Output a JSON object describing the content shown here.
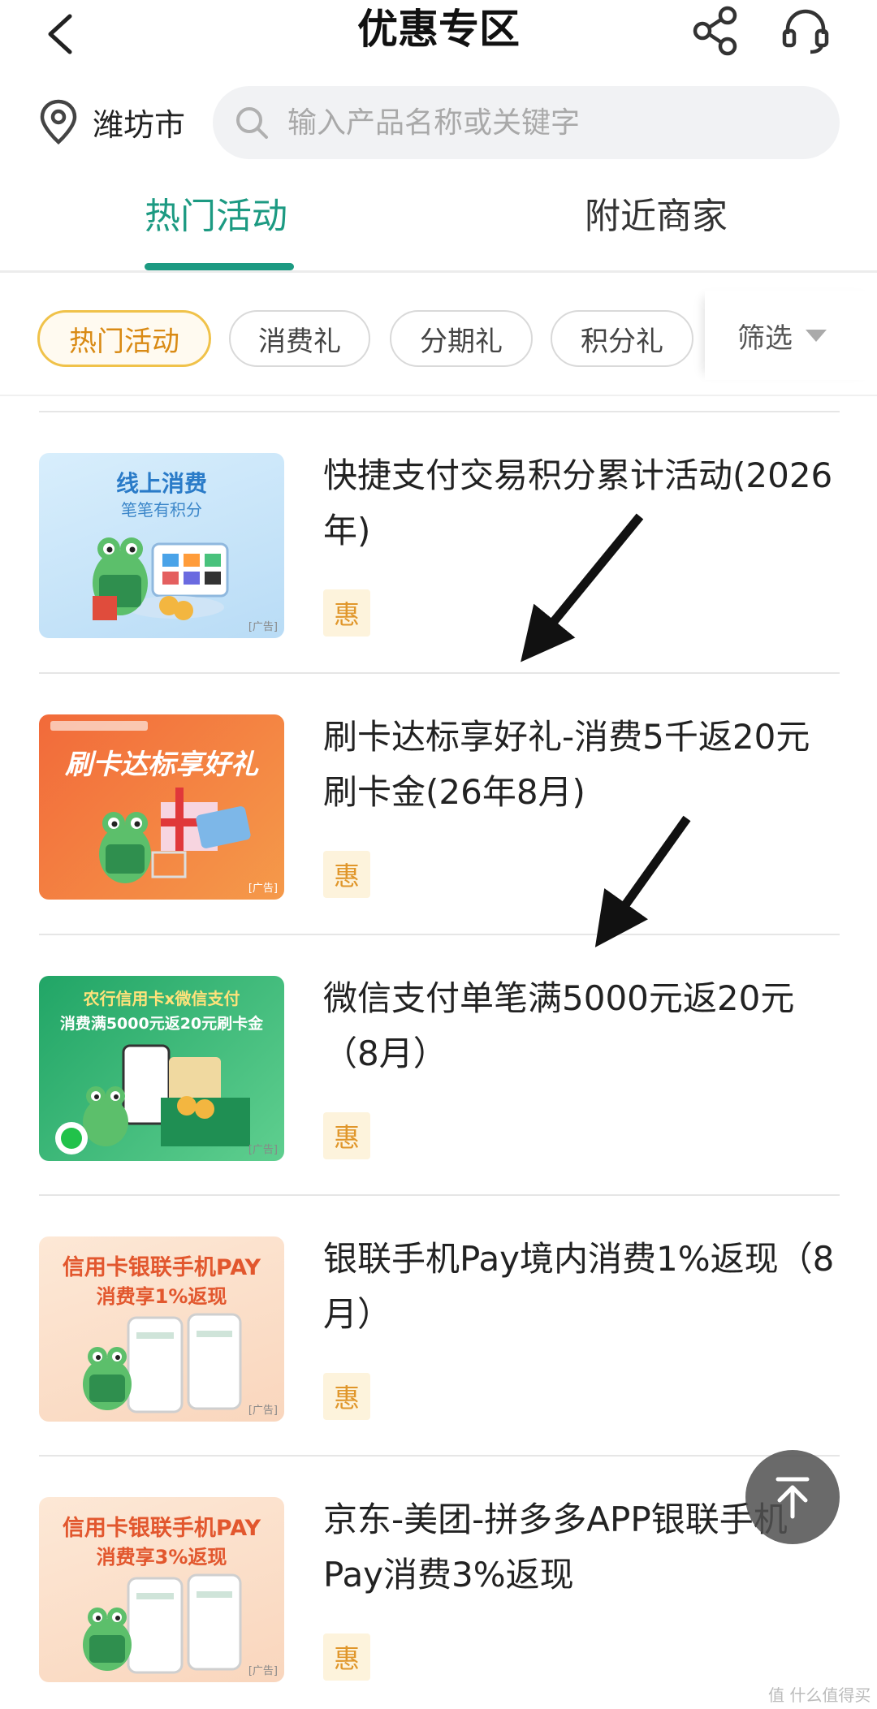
{
  "header": {
    "title": "优惠专区",
    "back_icon": "chevron-left-icon",
    "share_icon": "share-icon",
    "support_icon": "headset-icon"
  },
  "location": {
    "icon": "location-pin-icon",
    "city": "潍坊市"
  },
  "search": {
    "placeholder": "输入产品名称或关键字",
    "icon": "search-icon"
  },
  "tabs": [
    {
      "label": "热门活动",
      "active": true
    },
    {
      "label": "附近商家",
      "active": false
    }
  ],
  "chips": [
    {
      "label": "热门活动",
      "active": true
    },
    {
      "label": "消费礼",
      "active": false
    },
    {
      "label": "分期礼",
      "active": false
    },
    {
      "label": "积分礼",
      "active": false
    }
  ],
  "filter": {
    "label": "筛选"
  },
  "items": [
    {
      "title": "快捷支付交易积分累计活动(2026年)",
      "badge": "惠",
      "thumb": {
        "line1": "线上消费",
        "line2": "笔笔有积分",
        "ad": "[广告]"
      }
    },
    {
      "title": "刷卡达标享好礼-消费5千返20元刷卡金(26年8月)",
      "badge": "惠",
      "thumb": {
        "line1": "刷卡达标享好礼",
        "ad": "[广告]"
      }
    },
    {
      "title": "微信支付单笔满5000元返20元（8月）",
      "badge": "惠",
      "thumb": {
        "line1": "农行信用卡x微信支付",
        "line2": "消费满5000元返20元刷卡金",
        "ad": "[广告]"
      }
    },
    {
      "title": "银联手机Pay境内消费1%返现（8月）",
      "badge": "惠",
      "thumb": {
        "line1": "信用卡银联手机PAY",
        "line2": "消费享1%返现",
        "ad": "[广告]"
      }
    },
    {
      "title": "京东-美团-拼多多APP银联手机Pay消费3%返现",
      "badge": "惠",
      "thumb": {
        "line1": "信用卡银联手机PAY",
        "line2": "消费享3%返现",
        "ad": "[广告]"
      }
    }
  ],
  "back_to_top_icon": "arrow-up-to-top-icon",
  "watermark": "值 什么值得买",
  "colors": {
    "accent": "#1c9a82",
    "chip_active": "#f0c24a",
    "badge": "#e0962a"
  }
}
